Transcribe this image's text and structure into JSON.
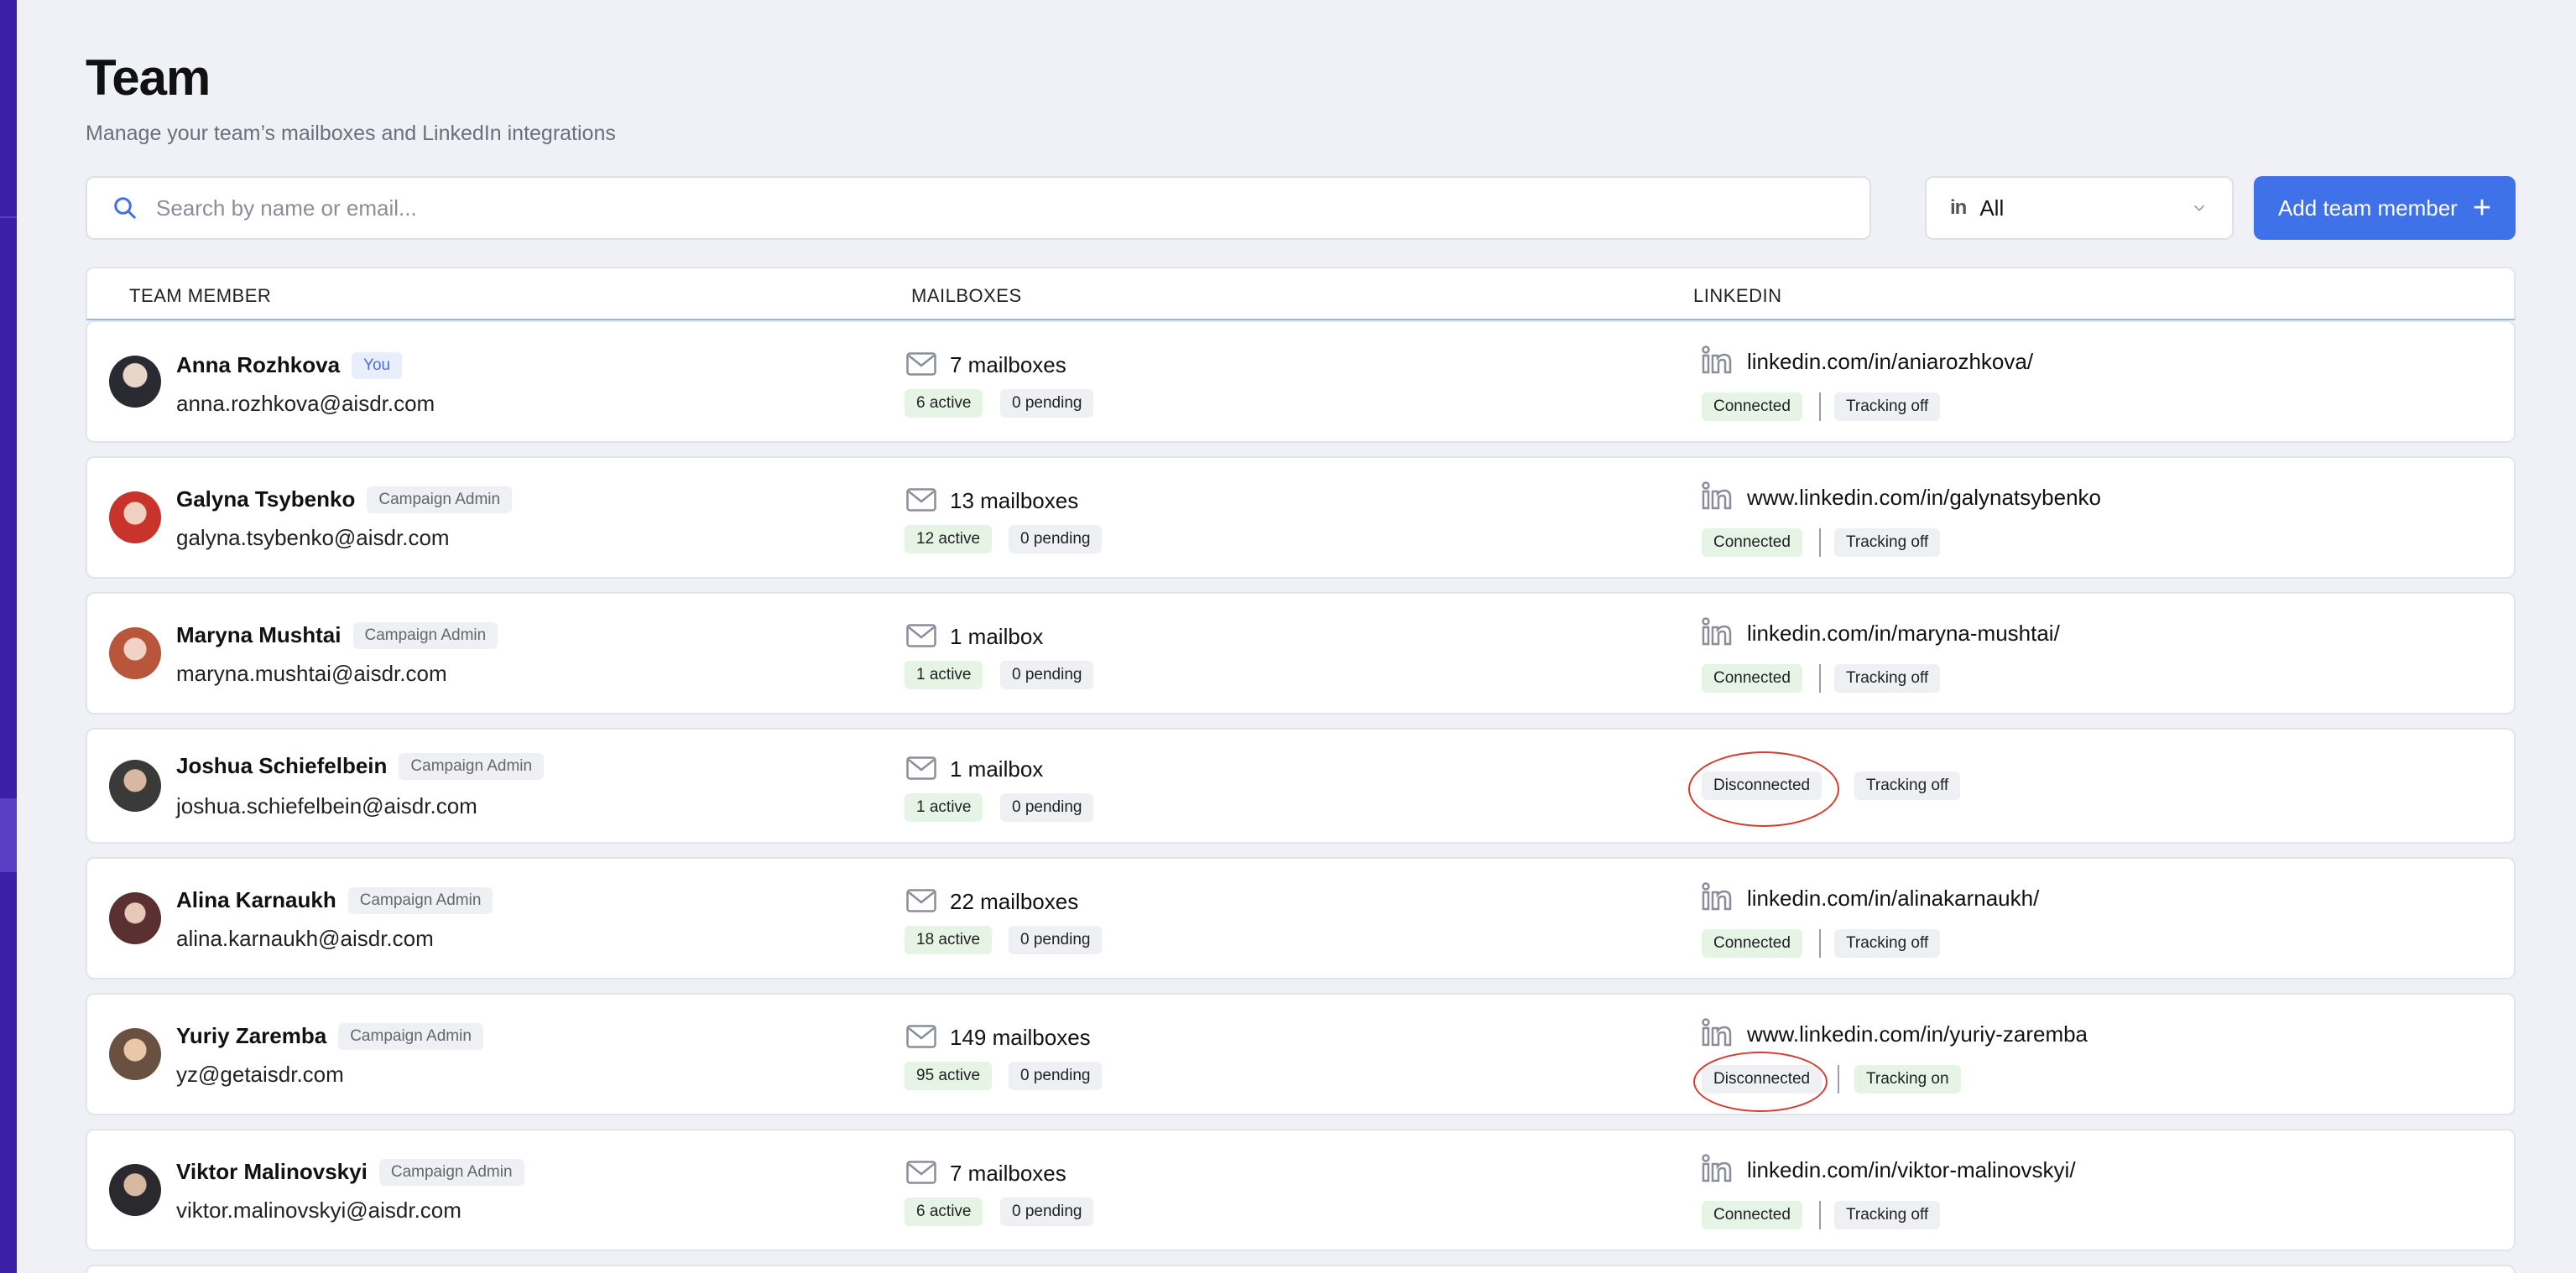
{
  "page": {
    "title": "Team",
    "subtitle": "Manage your team’s mailboxes and LinkedIn integrations"
  },
  "search": {
    "placeholder": "Search by name or email..."
  },
  "filter": {
    "icon": "linkedin-icon",
    "value": "All"
  },
  "add_button": {
    "label": "Add team member"
  },
  "table": {
    "headers": {
      "member": "TEAM MEMBER",
      "mailboxes": "MAILBOXES",
      "linkedin": "LINKEDIN"
    },
    "rows": [
      {
        "name": "Anna Rozhkova",
        "role": "You",
        "email": "anna.rozhkova@aisdr.com",
        "mailboxes": "7 mailboxes",
        "active": "6 active",
        "pending": "0 pending",
        "linkedin_url": "linkedin.com/in/aniarozhkova/",
        "status": "Connected",
        "tracking": "Tracking off"
      },
      {
        "name": "Galyna Tsybenko",
        "role": "Campaign Admin",
        "email": "galyna.tsybenko@aisdr.com",
        "mailboxes": "13 mailboxes",
        "active": "12 active",
        "pending": "0 pending",
        "linkedin_url": "www.linkedin.com/in/galynatsybenko",
        "status": "Connected",
        "tracking": "Tracking off"
      },
      {
        "name": "Maryna Mushtai",
        "role": "Campaign Admin",
        "email": "maryna.mushtai@aisdr.com",
        "mailboxes": "1 mailbox",
        "active": "1 active",
        "pending": "0 pending",
        "linkedin_url": "linkedin.com/in/maryna-mushtai/",
        "status": "Connected",
        "tracking": "Tracking off"
      },
      {
        "name": "Joshua Schiefelbein",
        "role": "Campaign Admin",
        "email": "joshua.schiefelbein@aisdr.com",
        "mailboxes": "1 mailbox",
        "active": "1 active",
        "pending": "0 pending",
        "linkedin_url": "",
        "status": "Disconnected",
        "tracking": "Tracking off"
      },
      {
        "name": "Alina Karnaukh",
        "role": "Campaign Admin",
        "email": "alina.karnaukh@aisdr.com",
        "mailboxes": "22 mailboxes",
        "active": "18 active",
        "pending": "0 pending",
        "linkedin_url": "linkedin.com/in/alinakarnaukh/",
        "status": "Connected",
        "tracking": "Tracking off"
      },
      {
        "name": "Yuriy Zaremba",
        "role": "Campaign Admin",
        "email": "yz@getaisdr.com",
        "mailboxes": "149 mailboxes",
        "active": "95 active",
        "pending": "0 pending",
        "linkedin_url": "www.linkedin.com/in/yuriy-zaremba",
        "status": "Disconnected",
        "tracking": "Tracking on"
      },
      {
        "name": "Viktor Malinovskyi",
        "role": "Campaign Admin",
        "email": "viktor.malinovskyi@aisdr.com",
        "mailboxes": "7 mailboxes",
        "active": "6 active",
        "pending": "0 pending",
        "linkedin_url": "linkedin.com/in/viktor-malinovskyi/",
        "status": "Connected",
        "tracking": "Tracking off"
      }
    ]
  },
  "colors": {
    "accent": "#3f72e8",
    "sidebar": "#3b1fa6",
    "annotation": "#d93a2e"
  }
}
